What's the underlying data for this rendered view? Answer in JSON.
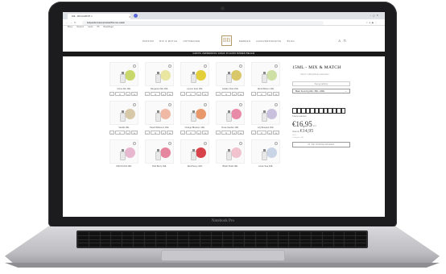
{
  "device": {
    "label": "Notebook Pro"
  },
  "browser": {
    "tab_title": "1ML - MIX & MATCH ✶",
    "url": "bettyandco.be/en/product/5ml-mix-match",
    "bookmarks": [
      "Bouvy",
      "Nieuw in",
      "Geurs",
      "PK",
      "Bestellingen"
    ]
  },
  "site": {
    "nav_left": [
      "PARFUM",
      "MIX & MATCH",
      "ONTDEKKEN"
    ],
    "logo": "BB",
    "nav_right": [
      "MERKEN",
      "HUIDVERZORGING",
      "BLOG"
    ],
    "promo": "GRATIS VERZENDING VANAF 25 EURO BINNEN BELGIË"
  },
  "products": [
    {
      "name": "Citrus Mix 1ML",
      "color": "#c9d86a"
    },
    {
      "name": "Bergamot Mix 1ML",
      "color": "#e8e6a0"
    },
    {
      "name": "Lemon Zest 1ML",
      "color": "#e3cf3a"
    },
    {
      "name": "Golden Pear 1ML",
      "color": "#d8c86a"
    },
    {
      "name": "Neroli Bloom 1ML",
      "color": "#cfe0a6"
    },
    {
      "name": "Vanilla 1ML",
      "color": "#d7c9a7"
    },
    {
      "name": "Peach Blossom 1ML",
      "color": "#f0b9a6"
    },
    {
      "name": "Orange Blossom 1ML",
      "color": "#e9986b"
    },
    {
      "name": "Rose Garden 1ML",
      "color": "#e98aa8"
    },
    {
      "name": "Lily Bouquet 1ML",
      "color": "#c9c0de"
    },
    {
      "name": "Wild Orchid 1ML",
      "color": "#e7b7cf"
    },
    {
      "name": "Pink Berry 1ML",
      "color": "#e5869e"
    },
    {
      "name": "Red Peony 1ML",
      "color": "#d8434b"
    },
    {
      "name": "Blush Petal 1ML",
      "color": "#f0c3ce"
    },
    {
      "name": "Azure Sea 1ML",
      "color": "#c9d4e6"
    }
  ],
  "qty": {
    "minus": "−",
    "value": "1",
    "plus": "+",
    "add": "+"
  },
  "sidebar": {
    "title": "15ML - MIX & MATCH",
    "subtitle": "Kies 5 x 1ML parfums naar keuze",
    "field": "Kies je parfums",
    "select": "Black Tea & Fig 1ML / 5ML / 15ML",
    "count": "5 items selected",
    "price": "€16,95",
    "price_suffix": "incl.",
    "was_label": "Waarde",
    "was_value": "€14,95",
    "meta": [
      "SKU: -",
      "Categorie: Mix"
    ],
    "add_button": "IN DE WINKELWAGEN"
  }
}
